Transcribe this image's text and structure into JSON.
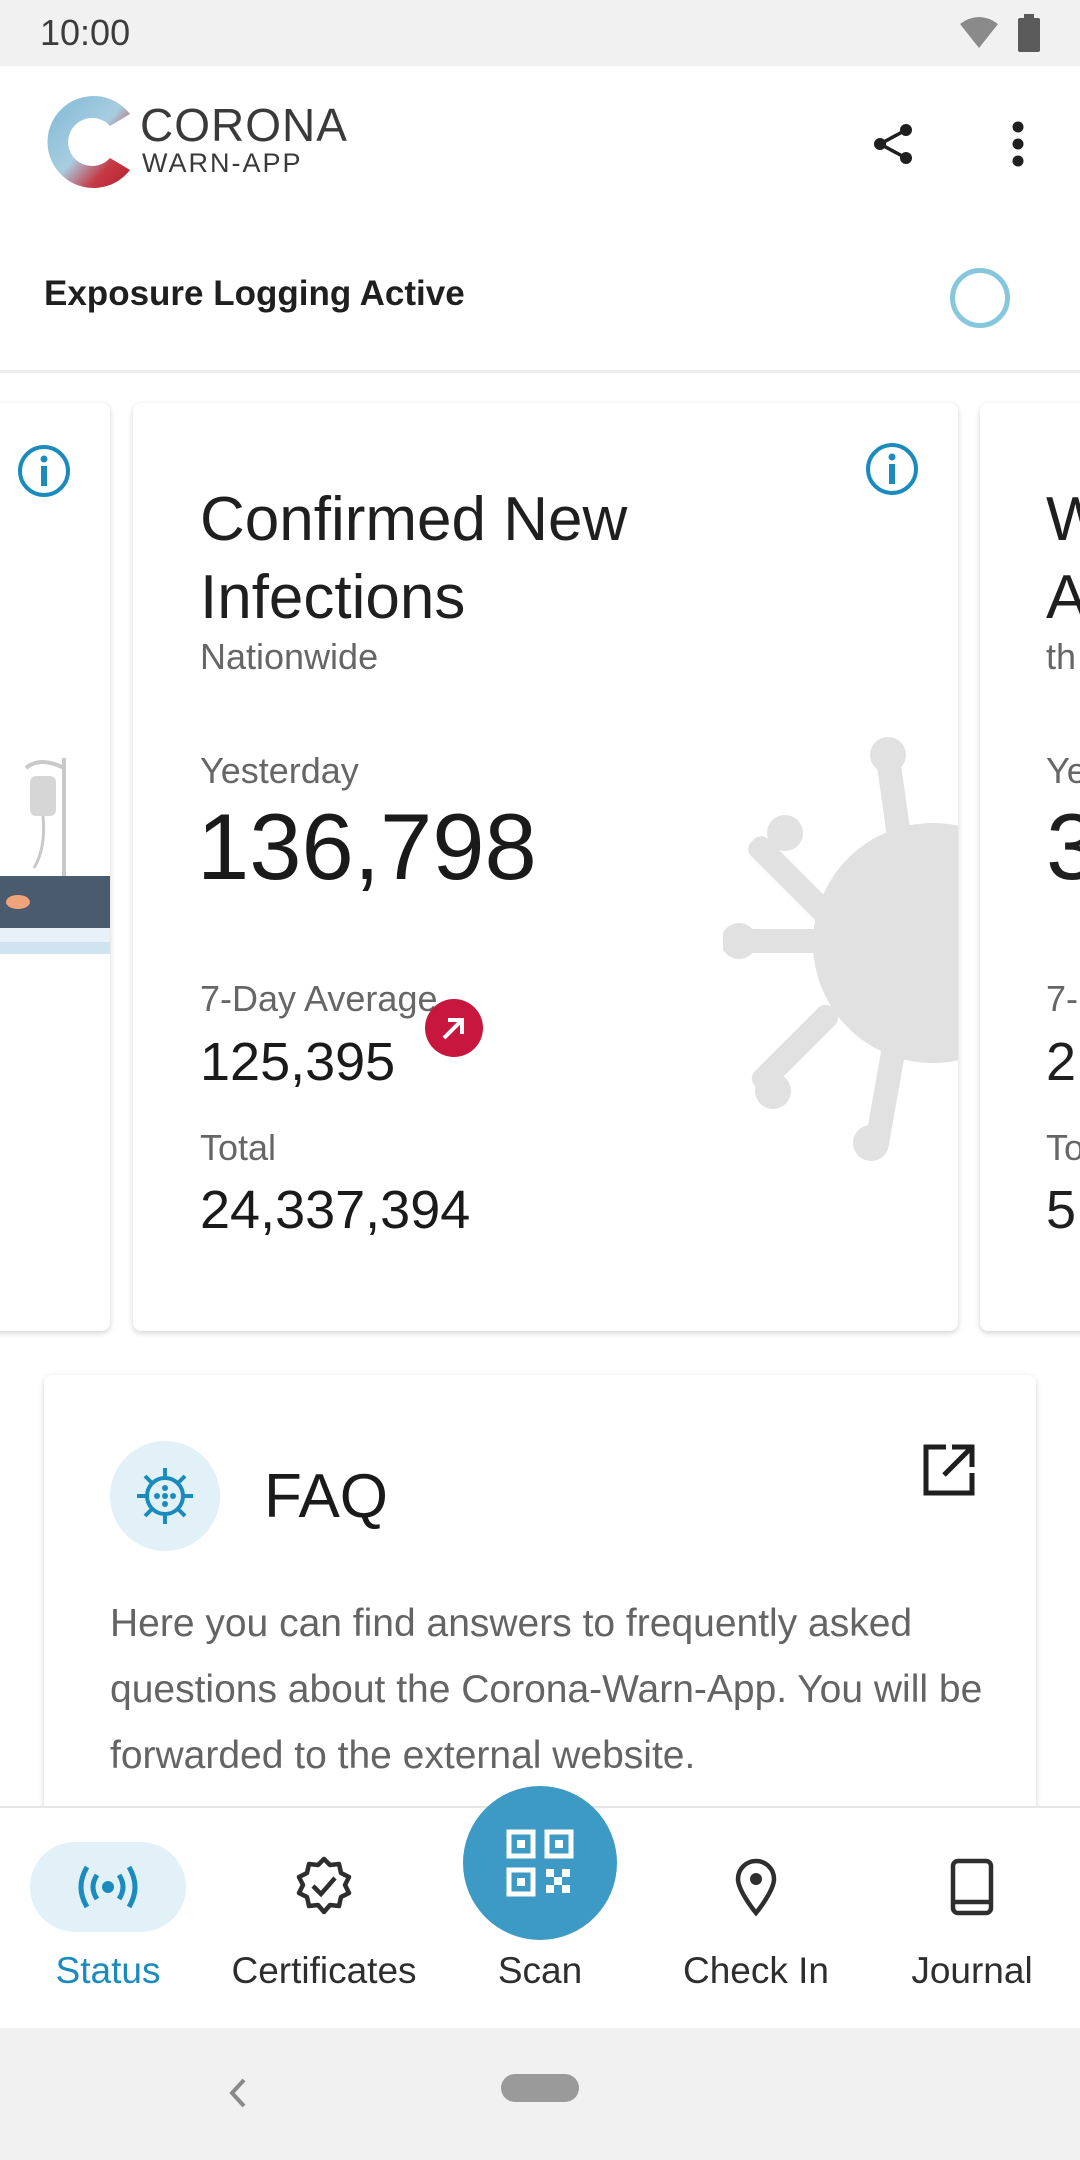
{
  "status_bar": {
    "time": "10:00"
  },
  "app_bar": {
    "logo_line1": "CORONA",
    "logo_line2": "WARN-APP"
  },
  "exposure": {
    "label": "Exposure Logging Active"
  },
  "cards": {
    "main": {
      "title_line1": "Confirmed New",
      "title_line2": "Infections",
      "subtitle": "Nationwide",
      "yesterday_label": "Yesterday",
      "yesterday_value": "136,798",
      "avg_label": "7-Day Average",
      "avg_value": "125,395",
      "total_label": "Total",
      "total_value": "24,337,394",
      "trend": "increasing"
    },
    "right_peek": {
      "title_line1": "W",
      "title_line2": "A",
      "subtitle": "th",
      "label1": "Ye",
      "value1": "3",
      "label2": "7-",
      "value2": "2",
      "label3": "To",
      "value3": "5,"
    }
  },
  "faq": {
    "title": "FAQ",
    "body": "Here you can find answers to frequently asked questions about the Corona-Warn-App. You will be forwarded to the external website."
  },
  "bottom_nav": {
    "items": [
      {
        "label": "Status",
        "active": true
      },
      {
        "label": "Certificates",
        "active": false
      },
      {
        "label": "Scan",
        "active": false
      },
      {
        "label": "Check In",
        "active": false
      },
      {
        "label": "Journal",
        "active": false
      }
    ]
  },
  "colors": {
    "accent": "#1b8bbd",
    "fab": "#3c9ac4",
    "trend_up": "#c7173e",
    "active_pill": "#e2f1f7"
  }
}
